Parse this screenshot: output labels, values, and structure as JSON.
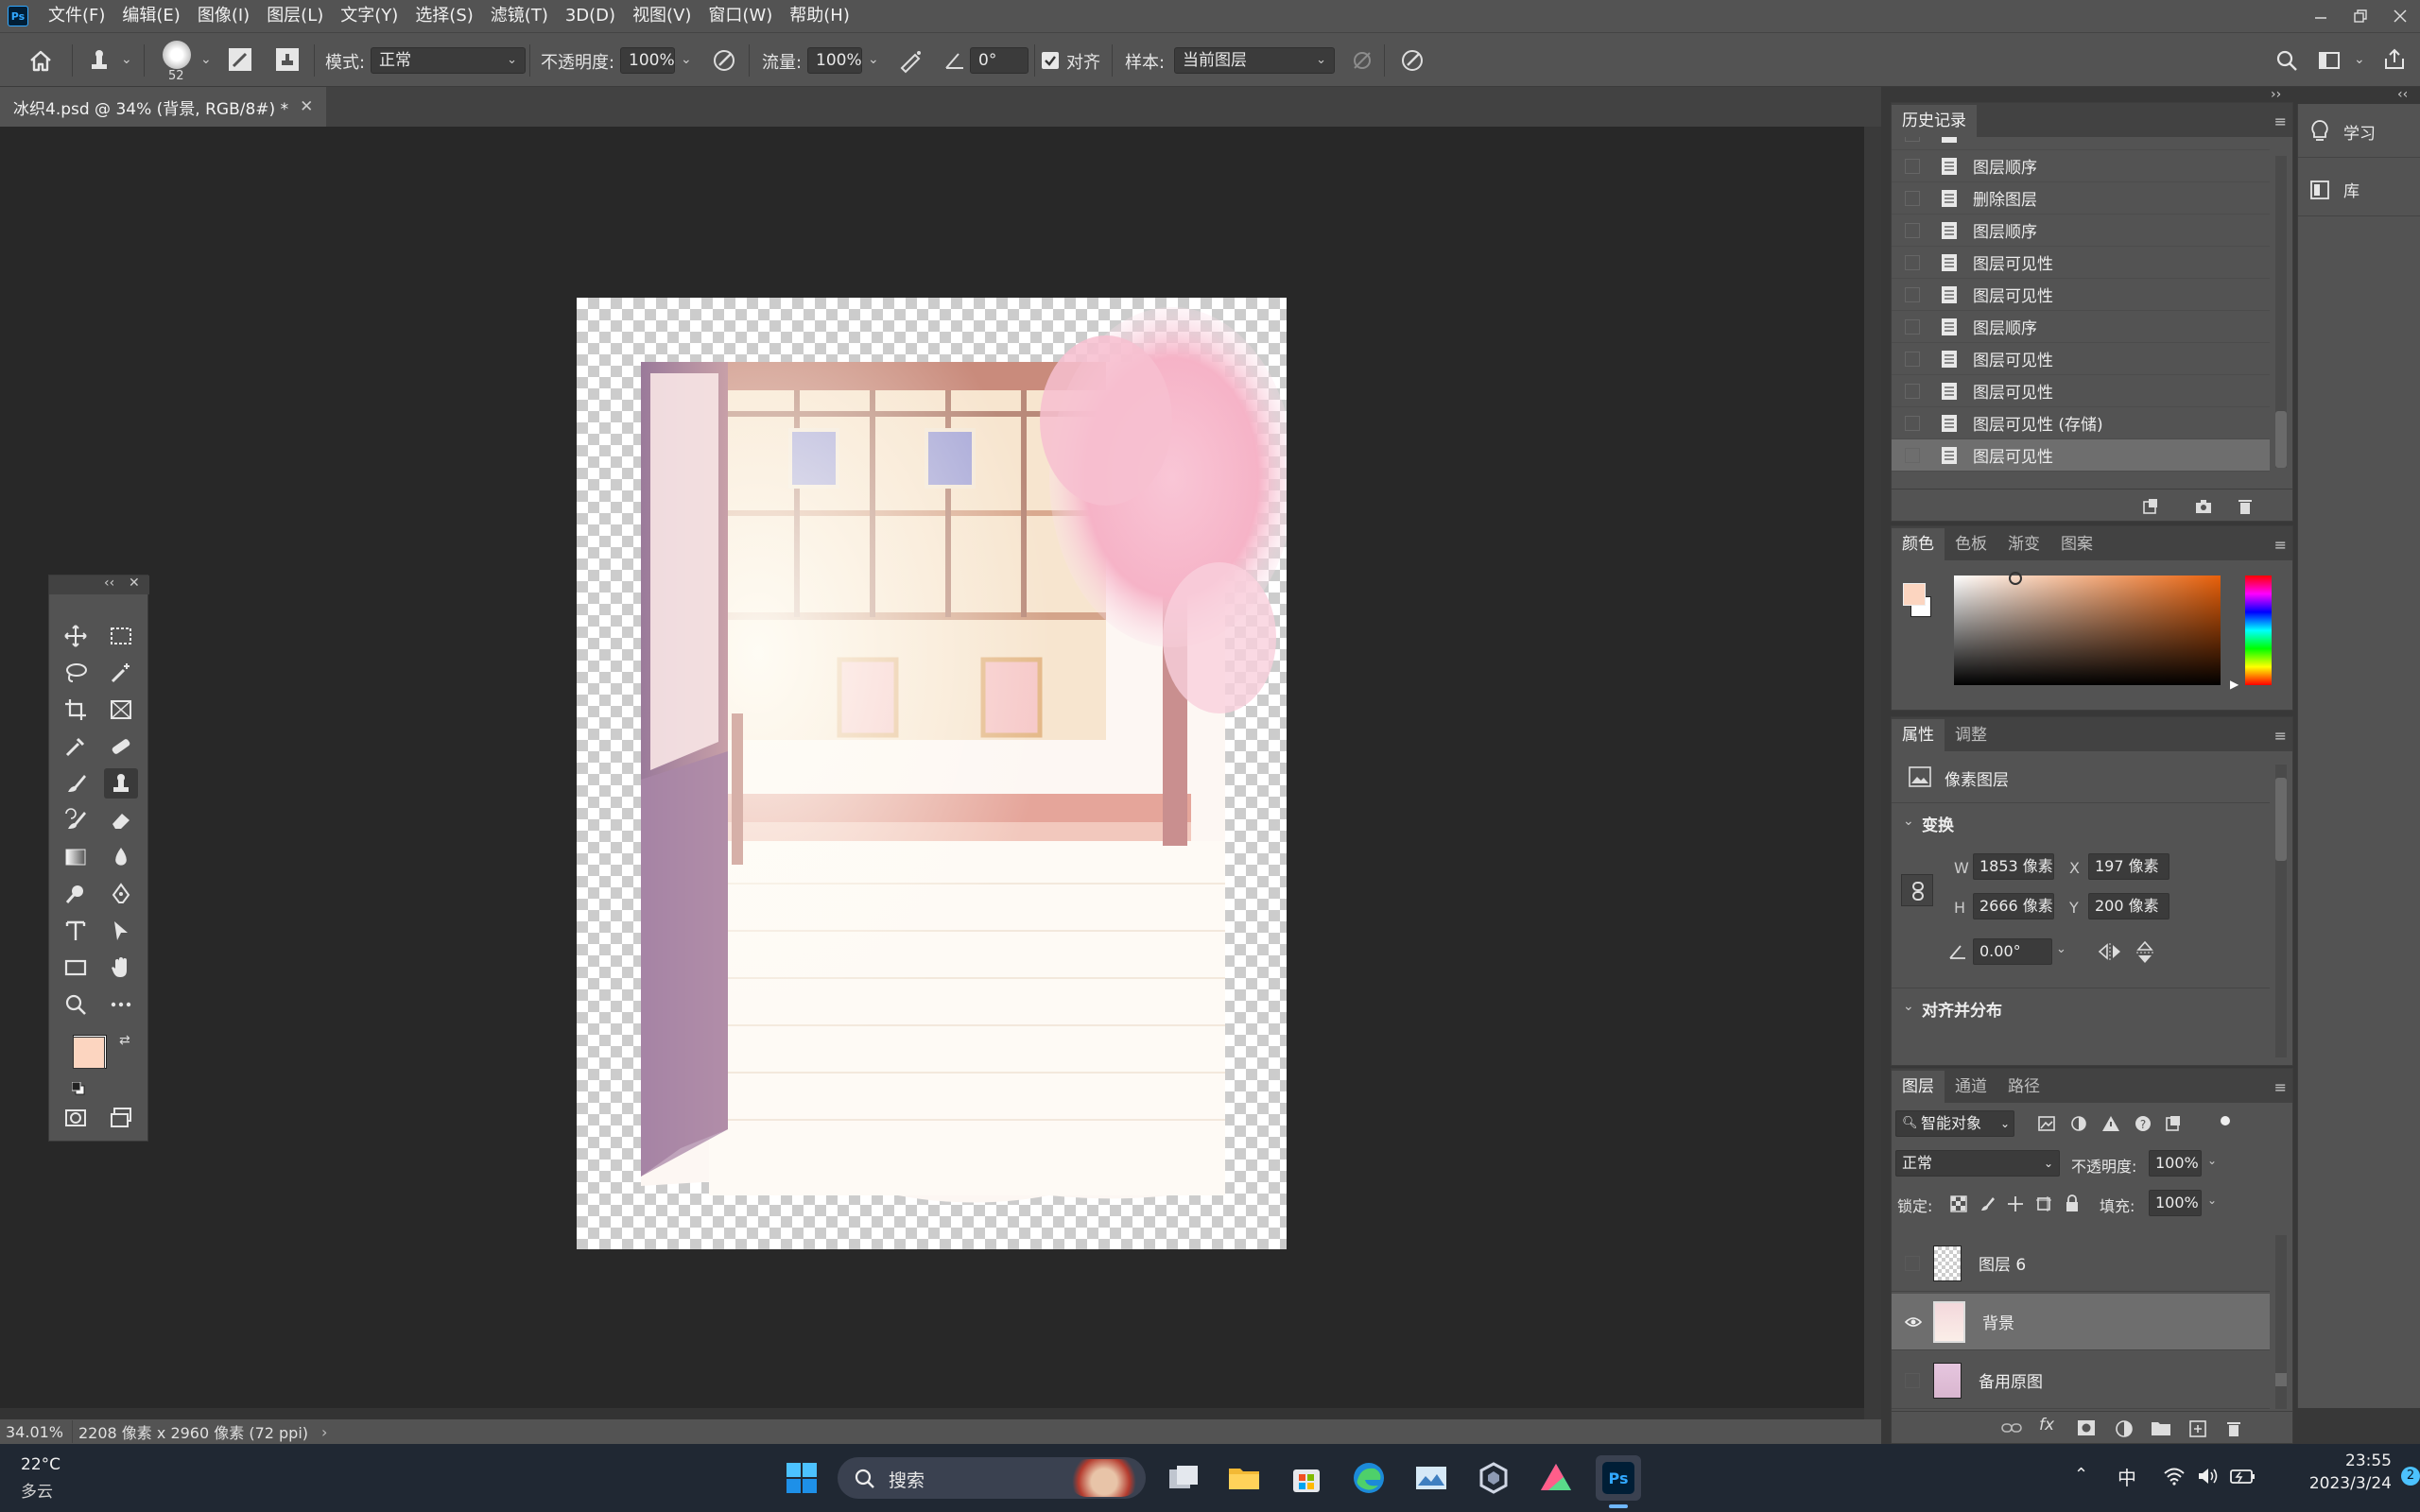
{
  "app": {
    "logo": "Ps"
  },
  "menu": [
    "文件(F)",
    "编辑(E)",
    "图像(I)",
    "图层(L)",
    "文字(Y)",
    "选择(S)",
    "滤镜(T)",
    "3D(D)",
    "视图(V)",
    "窗口(W)",
    "帮助(H)"
  ],
  "options": {
    "brush_size": "52",
    "mode_label": "模式:",
    "mode_value": "正常",
    "opacity_label": "不透明度:",
    "opacity_value": "100%",
    "flow_label": "流量:",
    "flow_value": "100%",
    "angle_value": "0°",
    "aligned_label": "对齐",
    "sample_label": "样本:",
    "sample_value": "当前图层"
  },
  "document": {
    "tab_title": "冰织4.psd @ 34% (背景, RGB/8#) *",
    "zoom": "34.01%",
    "size_info": "2208 像素 x 2960 像素 (72 ppi)"
  },
  "history": {
    "tab": "历史记录",
    "items": [
      "图层顺序",
      "删除图层",
      "图层顺序",
      "图层可见性",
      "图层可见性",
      "图层顺序",
      "图层可见性",
      "图层可见性",
      "图层可见性 (存储)",
      "图层可见性"
    ],
    "selected_index": 9
  },
  "color": {
    "tabs": [
      "颜色",
      "色板",
      "渐变",
      "图案"
    ],
    "foreground": "#fcd5c0",
    "background": "#ffffff",
    "hue_base": "#e8600a"
  },
  "properties": {
    "tabs": [
      "属性",
      "调整"
    ],
    "layer_type": "像素图层",
    "transform_title": "变换",
    "w": "1853 像素",
    "h": "2666 像素",
    "x": "197 像素",
    "y": "200 像素",
    "angle": "0.00°",
    "align_title": "对齐并分布"
  },
  "layers": {
    "tabs": [
      "图层",
      "通道",
      "路径"
    ],
    "filter": "智能对象",
    "blend": "正常",
    "opacity_label": "不透明度:",
    "opacity": "100%",
    "lock_label": "锁定:",
    "fill_label": "填充:",
    "fill": "100%",
    "items": [
      {
        "name": "图层 6",
        "visible": false,
        "selected": false
      },
      {
        "name": "背景",
        "visible": true,
        "selected": true
      },
      {
        "name": "备用原图",
        "visible": false,
        "selected": false
      }
    ]
  },
  "learn": {
    "items": [
      "学习",
      "库"
    ]
  },
  "taskbar": {
    "temp": "22°C",
    "weather": "多云",
    "search": "搜索",
    "ime": "中",
    "time": "23:55",
    "date": "2023/3/24",
    "badge": "2"
  }
}
